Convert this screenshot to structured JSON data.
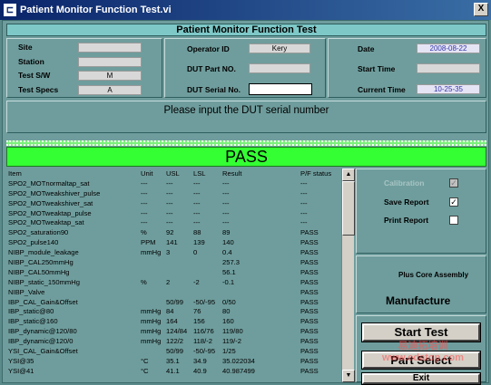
{
  "window": {
    "title": "Patient Monitor Function Test.vi",
    "close_label": "X"
  },
  "header": {
    "title": "Patient Monitor Function Test"
  },
  "left_info": {
    "site_label": "Site",
    "site_value": "",
    "station_label": "Station",
    "station_value": "",
    "test_sw_label": "Test S/W",
    "test_sw_value": "M",
    "test_specs_label": "Test Specs",
    "test_specs_value": "A"
  },
  "mid_info": {
    "operator_label": "Operator ID",
    "operator_value": "Kery",
    "dut_part_label": "DUT Part NO.",
    "dut_part_value": "",
    "dut_serial_label": "DUT Serial No.",
    "dut_serial_value": ""
  },
  "right_info": {
    "date_label": "Date",
    "date_value": "2008-08-22",
    "start_label": "Start Time",
    "start_value": "",
    "current_label": "Current Time",
    "current_value": "10-25-35"
  },
  "message": "Please input the DUT serial number",
  "result_banner": "PASS",
  "table": {
    "headers": [
      "Item",
      "Unit",
      "USL",
      "LSL",
      "Result",
      "P/F status"
    ],
    "rows": [
      [
        "SPO2_MOTnormaltap_sat",
        "---",
        "---",
        "---",
        "---",
        "---"
      ],
      [
        "SPO2_MOTweakshiver_pulse",
        "---",
        "---",
        "---",
        "---",
        "---"
      ],
      [
        "SPO2_MOTweakshiver_sat",
        "---",
        "---",
        "---",
        "---",
        "---"
      ],
      [
        "SPO2_MOTweaktap_pulse",
        "---",
        "---",
        "---",
        "---",
        "---"
      ],
      [
        "SPO2_MOTweaktap_sat",
        "---",
        "---",
        "---",
        "---",
        "---"
      ],
      [
        "SPO2_saturation90",
        "%",
        "92",
        "88",
        "89",
        "PASS"
      ],
      [
        "SPO2_pulse140",
        "PPM",
        "141",
        "139",
        "140",
        "PASS"
      ],
      [
        "NIBP_module_leakage",
        "mmHg",
        "3",
        "0",
        "0.4",
        "PASS"
      ],
      [
        "NIBP_CAL250mmHg",
        "",
        "",
        "",
        "257.3",
        "PASS"
      ],
      [
        "NIBP_CAL50mmHg",
        "",
        "",
        "",
        "56.1",
        "PASS"
      ],
      [
        "NIBP_static_150mmHg",
        "%",
        "2",
        "-2",
        "-0.1",
        "PASS"
      ],
      [
        "NIBP_Valve",
        "",
        "",
        "",
        "",
        "PASS"
      ],
      [
        "IBP_CAL_Gain&Offset",
        "",
        "50/99",
        "-50/-95",
        "0/50",
        "PASS"
      ],
      [
        "IBP_static@80",
        "mmHg",
        "84",
        "76",
        "80",
        "PASS"
      ],
      [
        "IBP_static@160",
        "mmHg",
        "164",
        "156",
        "160",
        "PASS"
      ],
      [
        "IBP_dynamic@120/80",
        "mmHg",
        "124/84",
        "116/76",
        "119/80",
        "PASS"
      ],
      [
        "IBP_dynamic@120/0",
        "mmHg",
        "122/2",
        "118/-2",
        "119/-2",
        "PASS"
      ],
      [
        "YSI_CAL_Gain&Offset",
        "",
        "50/99",
        "-50/-95",
        "1/25",
        "PASS"
      ],
      [
        "YSI@35",
        "°C",
        "35.1",
        "34.9",
        "35.022034",
        "PASS"
      ],
      [
        "YSI@41",
        "°C",
        "41.1",
        "40.9",
        "40.987499",
        "PASS"
      ]
    ]
  },
  "options": {
    "calibration_label": "Calibration",
    "calibration_checked": true,
    "save_report_label": "Save Report",
    "save_report_checked": true,
    "print_report_label": "Print Report",
    "print_report_checked": false,
    "check_mark": "✓"
  },
  "product": {
    "assembly_label": "Plus Core Assembly",
    "manufacture_label": "Manufacture"
  },
  "buttons": {
    "start_test": "Start Test",
    "part_select": "Part Select",
    "exit": "Exit"
  },
  "watermark": "易迪拓培训  www.edatop.com"
}
